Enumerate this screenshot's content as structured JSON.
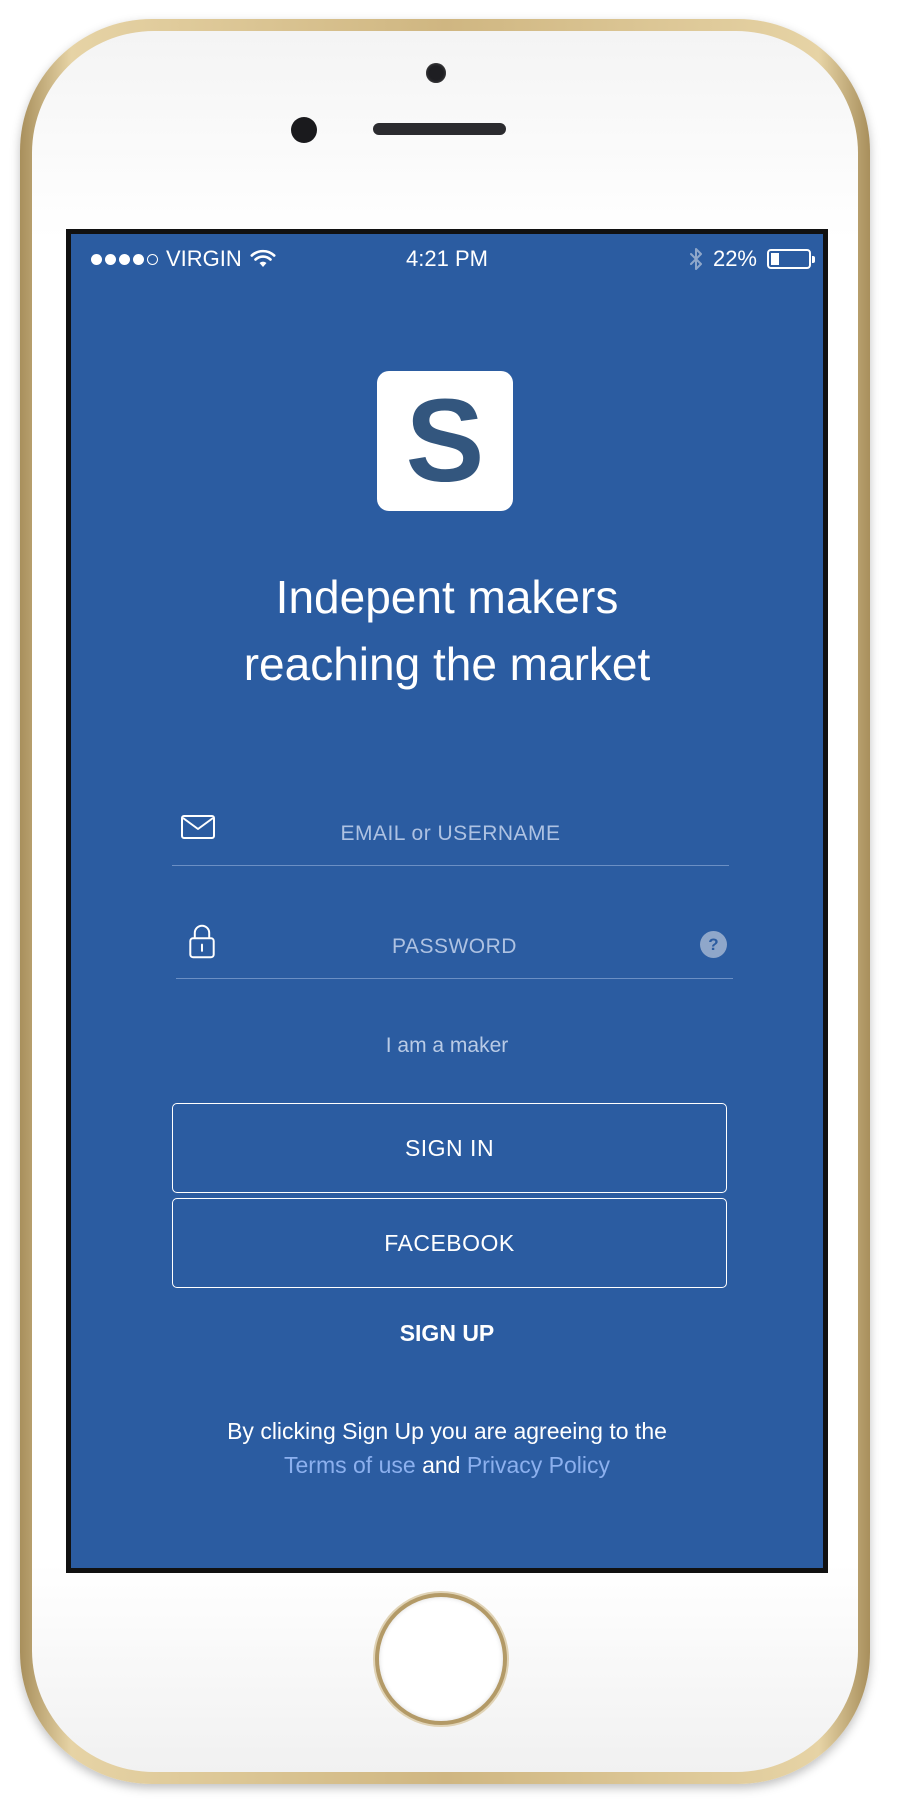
{
  "status_bar": {
    "carrier": "VIRGIN",
    "signal_bars_filled": 4,
    "signal_bars_total": 5,
    "time": "4:21 PM",
    "battery_percent_label": "22%",
    "battery_level": 0.22,
    "icons": [
      "signal-dots",
      "wifi-icon",
      "bluetooth-icon",
      "battery-icon"
    ]
  },
  "app": {
    "logo_letter": "S"
  },
  "headline": {
    "line1": "Indepent makers",
    "line2": "reaching the market"
  },
  "login_form": {
    "email_placeholder": "EMAIL or USERNAME",
    "email_value": "",
    "password_placeholder": "PASSWORD",
    "password_value": "",
    "help_icon_label": "?"
  },
  "actions": {
    "maker_link": "I am a maker",
    "sign_in_label": "SIGN IN",
    "facebook_label": "FACEBOOK",
    "sign_up_label": "SIGN UP"
  },
  "legal": {
    "prefix": "By clicking Sign Up you are agreeing to the",
    "terms_link": "Terms of use",
    "conjunction": "and",
    "privacy_link": "Privacy Policy"
  },
  "colors": {
    "screen_background": "#2b5ca1",
    "logo_letter": "#33567e",
    "link": "#8cb0ee",
    "phone_frame": "#cfb681"
  }
}
